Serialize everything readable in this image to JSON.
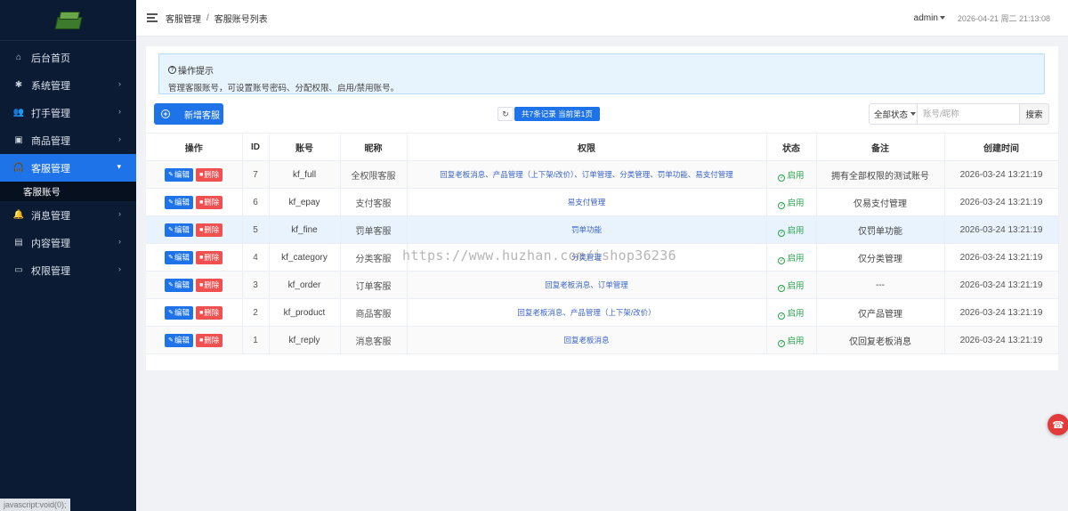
{
  "sidebar": {
    "items": [
      {
        "label": "后台首页",
        "icon": "home-icon",
        "glyph": "⌂",
        "has_arrow": false
      },
      {
        "label": "系统管理",
        "icon": "gear-icon",
        "glyph": "✱",
        "has_arrow": true
      },
      {
        "label": "打手管理",
        "icon": "users-icon",
        "glyph": "👥",
        "has_arrow": true
      },
      {
        "label": "商品管理",
        "icon": "bag-icon",
        "glyph": "▣",
        "has_arrow": true
      },
      {
        "label": "客服管理",
        "icon": "headset-icon",
        "glyph": "🎧",
        "has_arrow": true,
        "active": true
      },
      {
        "label": "消息管理",
        "icon": "bell-icon",
        "glyph": "🔔",
        "has_arrow": true
      },
      {
        "label": "内容管理",
        "icon": "file-icon",
        "glyph": "▤",
        "has_arrow": true
      },
      {
        "label": "权限管理",
        "icon": "monitor-icon",
        "glyph": "▭",
        "has_arrow": true
      }
    ],
    "submenu_label": "客服账号",
    "status_text": "javascript:void(0);"
  },
  "header": {
    "breadcrumb_parent": "客服管理",
    "breadcrumb_sep": "/",
    "breadcrumb_current": "客服账号列表",
    "user": "admin",
    "datetime": "2026-04-21 周二 21:13:08"
  },
  "tip": {
    "title": "操作提示",
    "text": "管理客服账号，可设置账号密码、分配权限、启用/禁用账号。"
  },
  "toolbar": {
    "add_label": "新增客服",
    "count_text": "共7条记录 当前第1页",
    "status_select": "全部状态",
    "search_placeholder": "账号/昵称",
    "search_label": "搜索"
  },
  "table": {
    "headers": [
      "操作",
      "ID",
      "账号",
      "昵称",
      "权限",
      "状态",
      "备注",
      "创建时间"
    ],
    "edit_label": "编辑",
    "delete_label": "删除",
    "rows": [
      {
        "id": "7",
        "account": "kf_full",
        "nickname": "全权限客服",
        "permissions": "回复老板消息、产品管理（上下架/改价）、订单管理、分类管理、罚单功能、易支付管理",
        "status": "启用",
        "remark": "拥有全部权限的测试账号",
        "created": "2026-03-24 13:21:19"
      },
      {
        "id": "6",
        "account": "kf_epay",
        "nickname": "支付客服",
        "permissions": "易支付管理",
        "status": "启用",
        "remark": "仅易支付管理",
        "created": "2026-03-24 13:21:19"
      },
      {
        "id": "5",
        "account": "kf_fine",
        "nickname": "罚单客服",
        "permissions": "罚单功能",
        "status": "启用",
        "remark": "仅罚单功能",
        "created": "2026-03-24 13:21:19"
      },
      {
        "id": "4",
        "account": "kf_category",
        "nickname": "分类客服",
        "permissions": "分类管理",
        "status": "启用",
        "remark": "仅分类管理",
        "created": "2026-03-24 13:21:19"
      },
      {
        "id": "3",
        "account": "kf_order",
        "nickname": "订单客服",
        "permissions": "回复老板消息、订单管理",
        "status": "启用",
        "remark": "---",
        "created": "2026-03-24 13:21:19"
      },
      {
        "id": "2",
        "account": "kf_product",
        "nickname": "商品客服",
        "permissions": "回复老板消息、产品管理（上下架/改价）",
        "status": "启用",
        "remark": "仅产品管理",
        "created": "2026-03-24 13:21:19"
      },
      {
        "id": "1",
        "account": "kf_reply",
        "nickname": "消息客服",
        "permissions": "回复老板消息",
        "status": "启用",
        "remark": "仅回复老板消息",
        "created": "2026-03-24 13:21:19"
      }
    ]
  },
  "watermark": "https://www.huzhan.com/ishop36236",
  "colors": {
    "primary": "#1e73e8",
    "danger": "#f05050",
    "success": "#26a34a",
    "sidebar_bg": "#0b1b33"
  }
}
